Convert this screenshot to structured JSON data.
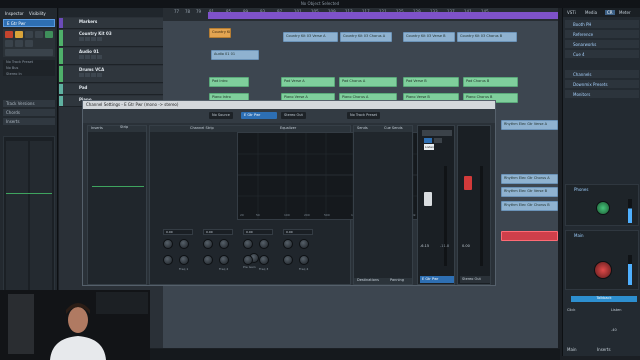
{
  "window": {
    "title": "No Object Selected"
  },
  "inspector": {
    "tabs": [
      "Inspector",
      "Visibility"
    ],
    "track_name": "E Gtr Pwr",
    "routing": [
      "No Track Preset",
      "No Bus",
      "Stereo In"
    ],
    "sections": [
      "Track Versions",
      "Chords",
      "Inserts"
    ]
  },
  "tracklist": {
    "tracks": [
      {
        "name": "Markers",
        "color": "#6b4bb8"
      },
      {
        "name": "Country Kit 03",
        "color": "#4fb06a"
      },
      {
        "name": "Audio 01",
        "color": "#4fb06a"
      },
      {
        "name": "Drums VCA",
        "color": "#4fb06a"
      },
      {
        "name": "Pad",
        "color": "#5fb0a0"
      },
      {
        "name": "Piano",
        "color": "#5fb0a0"
      }
    ]
  },
  "ruler": {
    "ticks": [
      "77",
      "78",
      "79",
      "81",
      "85",
      "89",
      "93",
      "97",
      "101",
      "105",
      "109",
      "113",
      "117",
      "121",
      "125",
      "129",
      "133",
      "137",
      "141",
      "145"
    ]
  },
  "clips": [
    {
      "label": "Country Kit 03",
      "kind": "orange"
    },
    {
      "label": "Country Kit 03 Verse A",
      "kind": "blue"
    },
    {
      "label": "Country Kit 03 Chorus A",
      "kind": "blue"
    },
    {
      "label": "Country Kit 03 Verse B",
      "kind": "blue"
    },
    {
      "label": "Country Kit 03 Chorus B",
      "kind": "blue"
    },
    {
      "label": "Audio 01 01",
      "kind": "blue"
    },
    {
      "label": "Pad Intro",
      "kind": "green"
    },
    {
      "label": "Pad Verse A",
      "kind": "green"
    },
    {
      "label": "Pad Chorus A",
      "kind": "green"
    },
    {
      "label": "Pad Verse B",
      "kind": "green"
    },
    {
      "label": "Pad Chorus B",
      "kind": "green"
    },
    {
      "label": "Piano Intro",
      "kind": "green"
    },
    {
      "label": "Piano Verse A",
      "kind": "green"
    },
    {
      "label": "Piano Chorus A",
      "kind": "green"
    },
    {
      "label": "Piano Verse B",
      "kind": "green"
    },
    {
      "label": "Piano Chorus B",
      "kind": "green"
    },
    {
      "label": "Rhythm Elec Gtr Verse A",
      "kind": "blue"
    },
    {
      "label": "Rhythm Elec Gtr Chorus A",
      "kind": "blue"
    },
    {
      "label": "Rhythm Elec Gtr Verse B",
      "kind": "blue"
    },
    {
      "label": "Rhythm Elec Gtr Chorus B",
      "kind": "blue"
    }
  ],
  "channel_settings": {
    "title": "Channel Settings - E Gtr Pwr (mono -> stereo)",
    "source": "No Source",
    "channel": "E Gtr Pwr",
    "output": "Stereo Out",
    "track_preset": "No Track Preset",
    "sections": {
      "inserts": "Inserts",
      "strip": "Strip",
      "channel_strip": "Channel Strip",
      "equalizer": "Equalizer",
      "sends": "Sends",
      "cue_sends": "Cue Sends",
      "inserts_tab": "Inserts",
      "routing_tab": "Routing",
      "destinations": "Destinations",
      "panning": "Panning"
    },
    "freq_ticks": [
      "20",
      "50",
      "100",
      "200",
      "500",
      "1k",
      "2k",
      "5k",
      "10k",
      "20k"
    ],
    "eq_bands": [
      {
        "gain": "0.00",
        "freq": "Freq 1"
      },
      {
        "gain": "0.00",
        "freq": "Freq 2"
      },
      {
        "gain": "0.00",
        "freq": "Freq 3"
      },
      {
        "gain": "0.00",
        "freq": "Freq 4"
      }
    ],
    "pre_gain": "Pre Gain",
    "fader_value": "-6.15",
    "fader_peak": "-11.8",
    "channel_label": "E Gtr Pwr",
    "out_fader_value": "0.00",
    "out_label": "Stereo Out",
    "tooltip": "Listen"
  },
  "right_zone": {
    "tabs": [
      "VSTi",
      "Media",
      "CR",
      "Meter"
    ],
    "items": [
      "Booth PH",
      "Reference",
      "Sonarworks",
      "Cue 4"
    ],
    "sections": [
      "Channels",
      "Downmix Presets",
      "Monitors"
    ],
    "phones_label": "Phones",
    "main_label": "Main",
    "talkback": "Talkback",
    "click": "Click",
    "listen": "Listen",
    "bottom_tabs": [
      "Main",
      "Inserts"
    ],
    "dim_value": "-40"
  }
}
